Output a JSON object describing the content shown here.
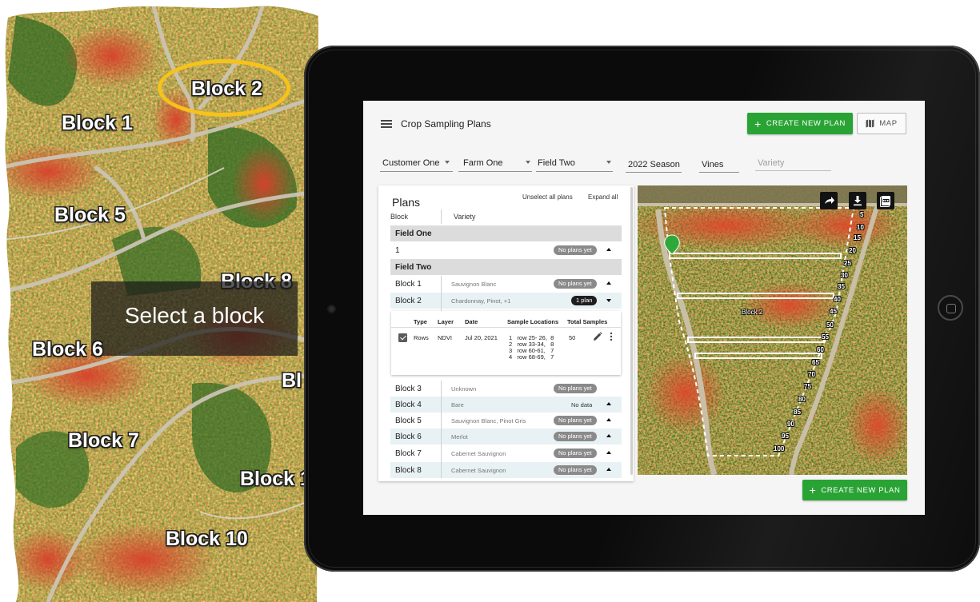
{
  "aerial": {
    "labels": {
      "block1": "Block 1",
      "block2": "Block 2",
      "block5": "Block 5",
      "block8": "Block 8",
      "block6": "Block 6",
      "block_bl": "Bl",
      "block7": "Block 7",
      "block1x": "Block 1",
      "block10": "Block 10"
    },
    "overlay_text": "Select a block",
    "highlight_color": "#f6c21c"
  },
  "app": {
    "title": "Crop Sampling Plans",
    "create_new_plan": "CREATE NEW PLAN",
    "map_button": "MAP",
    "accent": "#2aa335"
  },
  "filters": {
    "customer": "Customer One",
    "farm": "Farm One",
    "field": "Field Two",
    "season": "2022 Season",
    "crop": "Vines",
    "variety_placeholder": "Variety"
  },
  "plans": {
    "title": "Plans",
    "unselect_all": "Unselect all plans",
    "expand_all": "Expand all",
    "col_block": "Block",
    "col_variety": "Variety",
    "groups": [
      {
        "name": "Field One"
      },
      {
        "name": "Field Two"
      }
    ],
    "rows": [
      {
        "block": "1",
        "variety": "",
        "status": "No plans yet"
      },
      {
        "block": "Block 1",
        "variety": "Sauvignon Blanc",
        "status": "No plans yet"
      },
      {
        "block": "Block 2",
        "variety": "Chardonnay, Pinot, +1",
        "status": "1 plan"
      },
      {
        "block": "Block 3",
        "variety": "Unknown",
        "status": "No plans yet"
      },
      {
        "block": "Block 4",
        "variety": "Bare",
        "status": "No data"
      },
      {
        "block": "Block 5",
        "variety": "Sauvignon Blanc, Pinot Gris",
        "status": "No plans yet"
      },
      {
        "block": "Block 6",
        "variety": "Merlot",
        "status": "No plans yet"
      },
      {
        "block": "Block 7",
        "variety": "Cabernet Sauvignon",
        "status": "No plans yet"
      },
      {
        "block": "Block 8",
        "variety": "Cabernet Sauvignon",
        "status": "No plans yet"
      }
    ],
    "plan_detail": {
      "headers": {
        "type": "Type",
        "layer": "Layer",
        "date": "Date",
        "locations": "Sample Locations",
        "total": "Total Samples"
      },
      "type": "Rows",
      "layer": "NDVI",
      "date": "Jul 20, 2021",
      "locations": [
        "1   row 25- 26,  8",
        "2   row 33-34,   8",
        "3   row 60-61,   7",
        "4   row 68-69,   7"
      ],
      "total": "50"
    }
  },
  "map": {
    "block_label": "Block 2",
    "row_numbers": [
      "5",
      "10",
      "15",
      "20",
      "25",
      "30",
      "35",
      "40",
      "45",
      "50",
      "55",
      "60",
      "65",
      "70",
      "75",
      "80",
      "85",
      "90",
      "95",
      "100"
    ]
  }
}
